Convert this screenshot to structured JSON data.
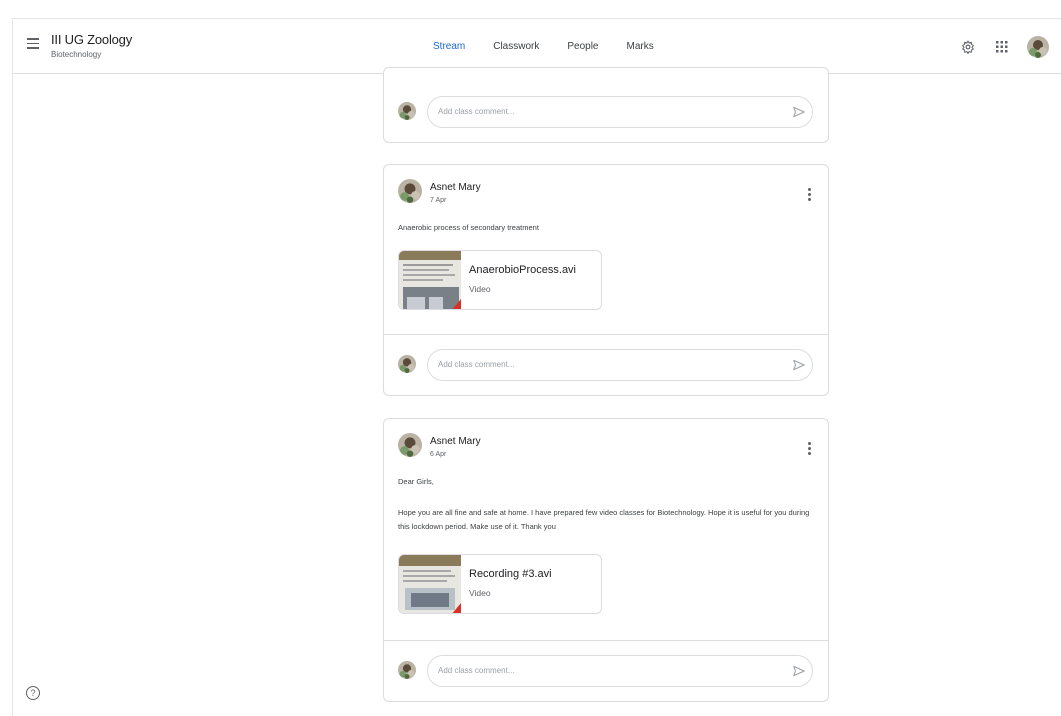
{
  "header": {
    "class_title": "III UG Zoology",
    "class_subtitle": "Biotechnology",
    "tabs": [
      {
        "label": "Stream",
        "active": true
      },
      {
        "label": "Classwork",
        "active": false
      },
      {
        "label": "People",
        "active": false
      },
      {
        "label": "Marks",
        "active": false
      }
    ],
    "icons": [
      "menu-icon",
      "settings-icon",
      "apps-grid-icon",
      "account-avatar"
    ]
  },
  "comment_placeholder": "Add class comment...",
  "posts": [
    {
      "author": "Asnet Mary",
      "date": "7 Apr",
      "text": "Anaerobic process of secondary treatment",
      "attachment": {
        "name": "AnaerobioProcess.avi",
        "type": "Video"
      }
    },
    {
      "author": "Asnet Mary",
      "date": "6 Apr",
      "greeting": "Dear Girls,",
      "text": "Hope you are all fine and safe at home. I have prepared few video classes for Biotechnology. Hope it is useful for you during this lockdown period. Make use of it. Thank you",
      "attachment": {
        "name": "Recording #3.avi",
        "type": "Video"
      }
    }
  ],
  "colors": {
    "accent": "#1967d2",
    "border": "#dadce0",
    "text": "#3c4043"
  }
}
